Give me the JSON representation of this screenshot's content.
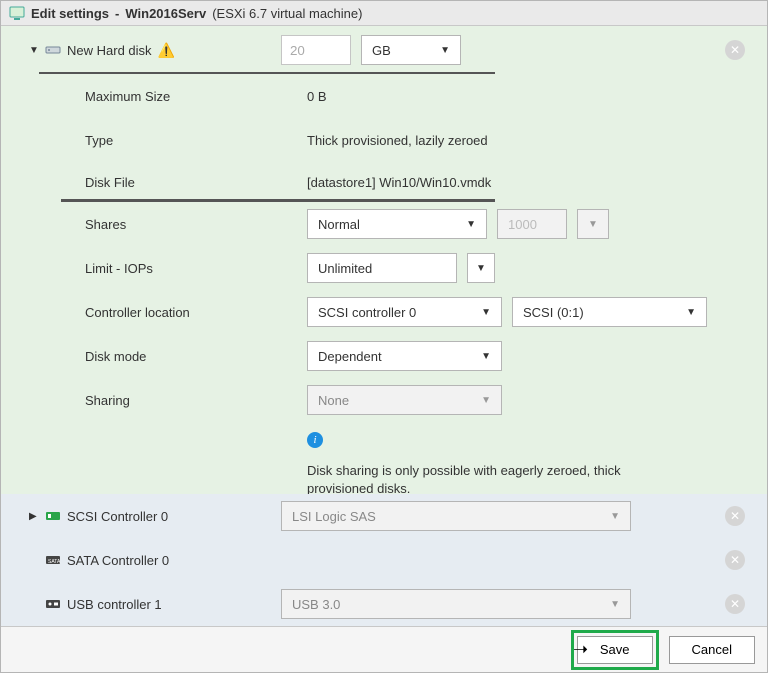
{
  "title": {
    "icon": "vm-icon",
    "app": "Edit settings",
    "vm": "Win2016Serv",
    "paren": "(ESXi 6.7 virtual machine)"
  },
  "newDisk": {
    "label": "New Hard disk",
    "size_value": "20",
    "size_unit": "GB",
    "maxsize_label": "Maximum Size",
    "maxsize_value": "0 B",
    "type_label": "Type",
    "type_value": "Thick provisioned, lazily zeroed",
    "diskfile_label": "Disk File",
    "diskfile_value": "[datastore1] Win10/Win10.vmdk",
    "shares_label": "Shares",
    "shares_value": "Normal",
    "shares_num": "1000",
    "limit_label": "Limit - IOPs",
    "limit_value": "Unlimited",
    "ctrl_label": "Controller location",
    "ctrl_value": "SCSI controller 0",
    "ctrl_pos": "SCSI (0:1)",
    "mode_label": "Disk mode",
    "mode_value": "Dependent",
    "sharing_label": "Sharing",
    "sharing_value": "None",
    "info_text": "Disk sharing is only possible with eagerly zeroed, thick provisioned disks."
  },
  "devices": {
    "scsi_label": "SCSI Controller 0",
    "scsi_value": "LSI Logic SAS",
    "sata_label": "SATA Controller 0",
    "usb_label": "USB controller 1",
    "usb_value": "USB 3.0"
  },
  "footer": {
    "save": "Save",
    "cancel": "Cancel"
  }
}
